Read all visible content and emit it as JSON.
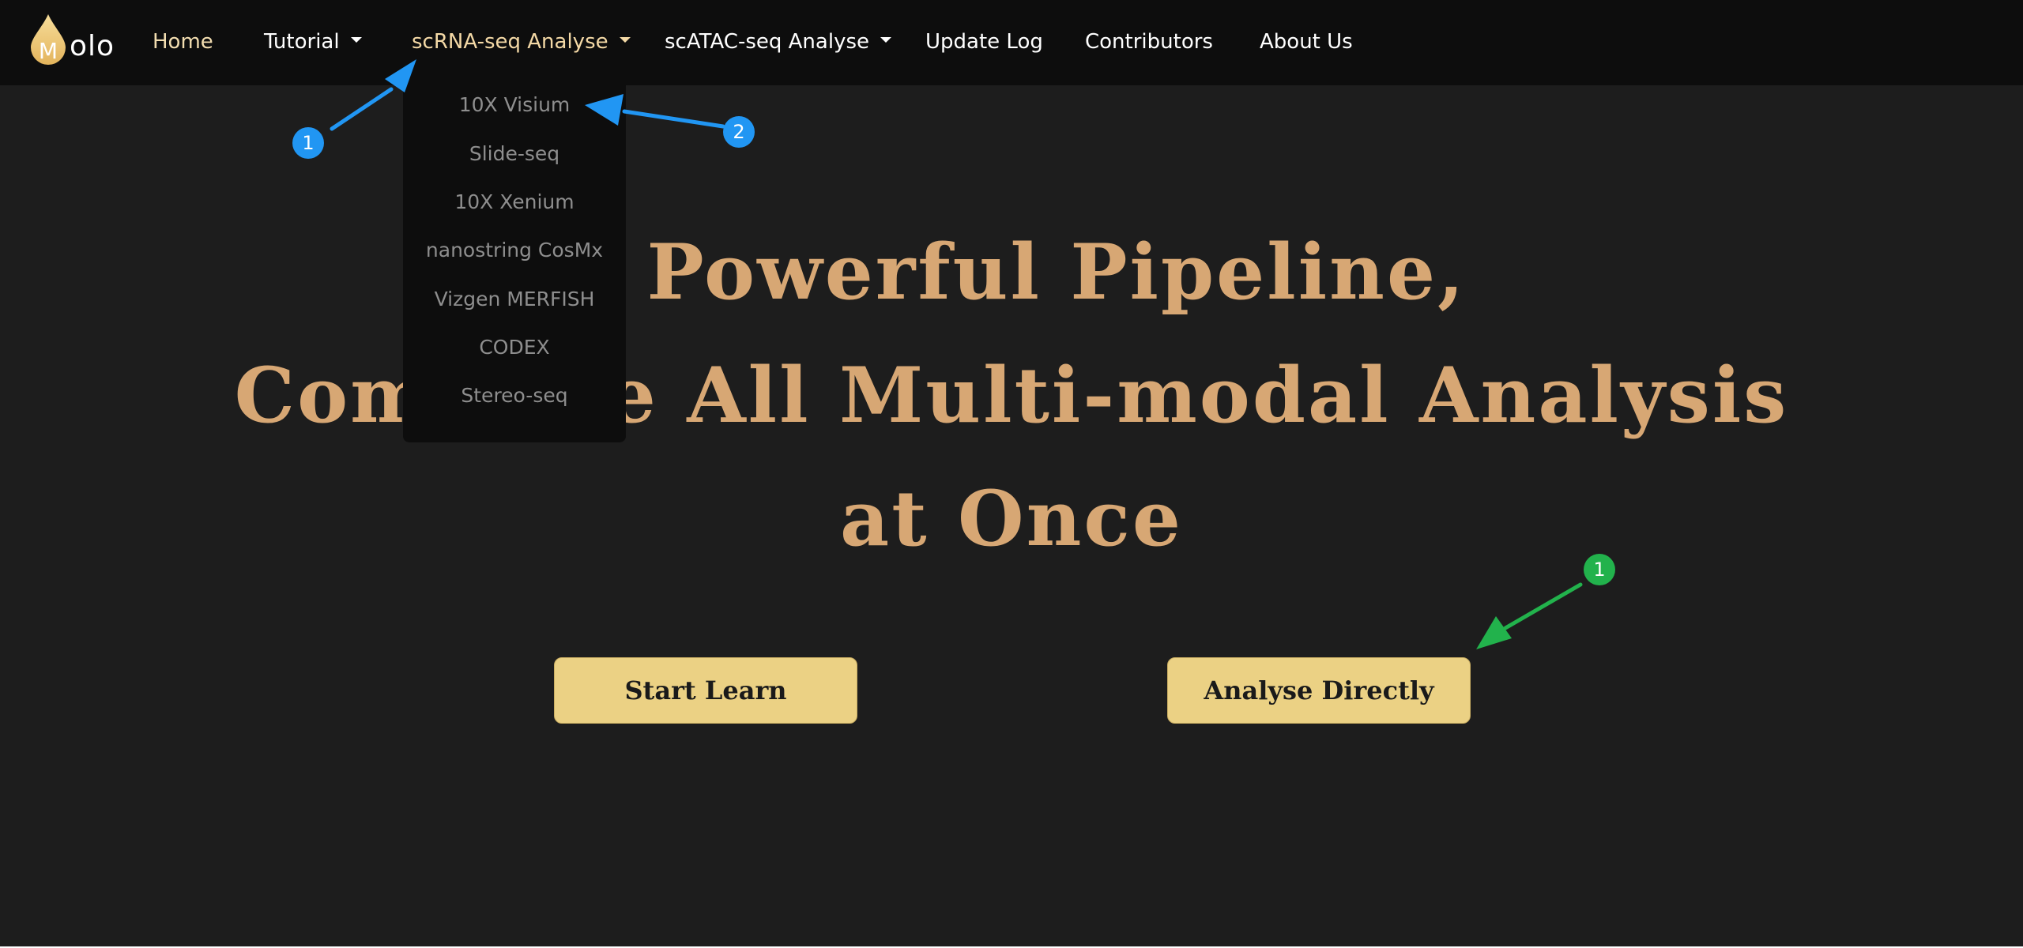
{
  "navbar": {
    "logo_text": "olo",
    "items": [
      {
        "label": "Home"
      },
      {
        "label": "Tutorial"
      },
      {
        "label": "scRNA-seq Analyse"
      },
      {
        "label": "scATAC-seq Analyse"
      },
      {
        "label": "Update Log"
      },
      {
        "label": "Contributors"
      },
      {
        "label": "About Us"
      }
    ]
  },
  "dropdown": {
    "items": [
      {
        "label": "10X Visium"
      },
      {
        "label": "Slide-seq"
      },
      {
        "label": "10X Xenium"
      },
      {
        "label": "nanostring CosMx"
      },
      {
        "label": "Vizgen MERFISH"
      },
      {
        "label": "CODEX"
      },
      {
        "label": "Stereo-seq"
      }
    ]
  },
  "hero": {
    "line1": "A Powerful Pipeline,",
    "line2": "Complete All Multi-modal Analysis",
    "line3": "at Once"
  },
  "buttons": {
    "start_learn": "Start Learn",
    "analyse_directly": "Analyse Directly"
  },
  "annotations": {
    "blue_badge_1": "1",
    "blue_badge_2": "2",
    "green_badge_1": "1"
  },
  "colors": {
    "page_background": "#1d1d1d",
    "navbar_background": "#0d0d0d",
    "hero_text": "#d7a774",
    "button_fill": "#ebd184",
    "annotation_blue": "#2196f3",
    "annotation_green": "#22b24c"
  }
}
